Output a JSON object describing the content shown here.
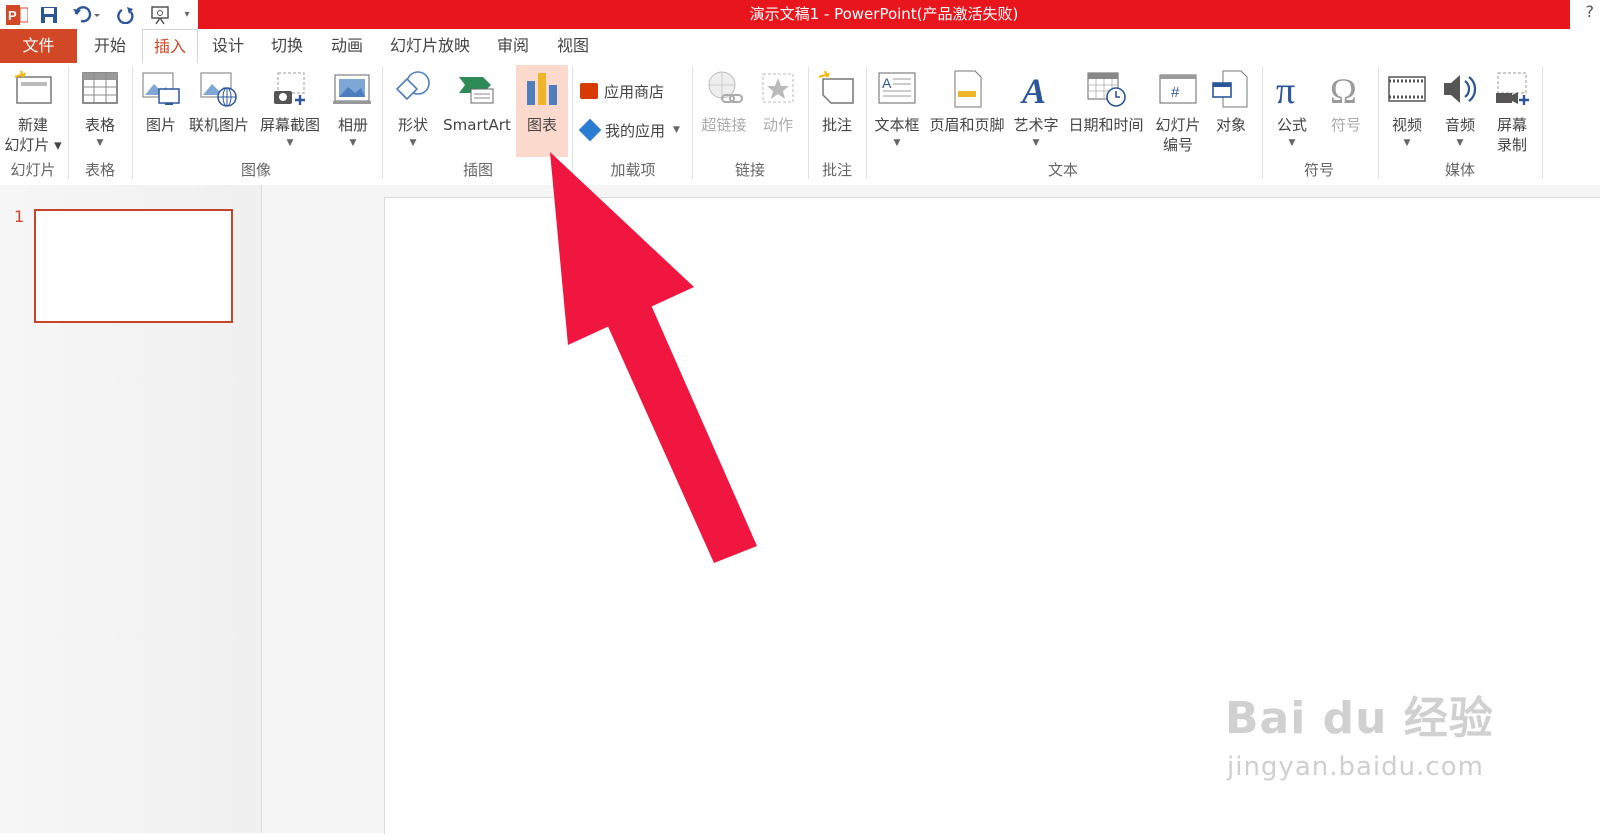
{
  "window": {
    "title": "演示文稿1 - PowerPoint(产品激活失败)",
    "help": "?"
  },
  "tabs": [
    {
      "label": "文件"
    },
    {
      "label": "开始"
    },
    {
      "label": "插入"
    },
    {
      "label": "设计"
    },
    {
      "label": "切换"
    },
    {
      "label": "动画"
    },
    {
      "label": "幻灯片放映"
    },
    {
      "label": "审阅"
    },
    {
      "label": "视图"
    }
  ],
  "active_tab": "插入",
  "ribbon": {
    "new_slide": "新建",
    "new_slide2": "幻灯片",
    "table": "表格",
    "picture": "图片",
    "online_picture": "联机图片",
    "screenshot": "屏幕截图",
    "album": "相册",
    "shapes": "形状",
    "smartart": "SmartArt",
    "chart": "图表",
    "app_store": "应用商店",
    "my_apps": "我的应用",
    "hyperlink": "超链接",
    "action": "动作",
    "comment": "批注",
    "textbox": "文本框",
    "header_footer": "页眉和页脚",
    "wordart": "艺术字",
    "datetime": "日期和时间",
    "slide_number": "幻灯片",
    "slide_number2": "编号",
    "object": "对象",
    "equation": "公式",
    "symbol": "符号",
    "video": "视频",
    "audio": "音频",
    "screen_record": "屏幕",
    "screen_record2": "录制",
    "groups": {
      "slides": "幻灯片",
      "tables": "表格",
      "images": "图像",
      "illustrations": "插图",
      "addins": "加载项",
      "links": "链接",
      "comments": "批注",
      "text": "文本",
      "symbols": "符号",
      "media": "媒体"
    }
  },
  "thumbnail": {
    "number": "1"
  },
  "watermark": {
    "brand": "Bai du 经验",
    "url": "jingyan.baidu.com"
  },
  "colors": {
    "title_red": "#e8161c",
    "file_tab": "#d24726",
    "arrow": "#f0163f",
    "chart_highlight": "#fbd9cd"
  }
}
